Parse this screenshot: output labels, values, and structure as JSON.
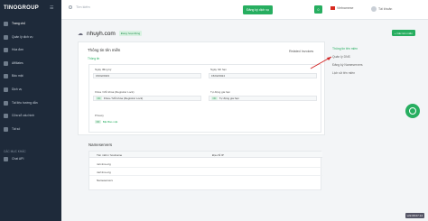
{
  "brand": {
    "logo_text": "TINOGROUP",
    "accent": "#27ae60",
    "sidebar_bg": "#1e2a3a"
  },
  "sidebar": {
    "items": [
      {
        "label": "Trang chủ",
        "active": true
      },
      {
        "label": "Quản lý dịch vụ"
      },
      {
        "label": "Hóa đơn"
      },
      {
        "label": "Affiliates"
      },
      {
        "label": "Bảo mật"
      },
      {
        "label": "Dịch vụ"
      },
      {
        "label": "Tài liệu hướng dẫn"
      },
      {
        "label": "Cửa sổ cấu hình"
      },
      {
        "label": "Tài số"
      }
    ],
    "section_label": "CÁC MỤC KHÁC",
    "extra_item": "Chat API"
  },
  "topbar": {
    "search_placeholder": "Tìm kiếm",
    "register_button": "Đăng ký dịch vụ",
    "cart_count": "0",
    "language": "Vietnamese",
    "user_name": "Tài khoản"
  },
  "domain": {
    "name": "nhuyh.com",
    "status": "Đang hoạt động",
    "add_button": "+ Các tên miền"
  },
  "details": {
    "title": "Thông tin tên miền",
    "tab_overview": "Thông tin",
    "reg_date_label": "Ngày đăng ký",
    "reg_date_value": "15/02/2023",
    "exp_date_label": "Ngày hết hạn",
    "exp_date_value": "15/02/2024",
    "lock_label": "Khóa / Mở khóa (Registrar Lock)",
    "lock_pill": "ON",
    "lock_value": "Khóa / Mở khóa (Registrar Lock)",
    "renew_label": "Tự động gia hạn",
    "renew_pill": "ON",
    "renew_value": "Tự động gia hạn",
    "privacy_label": "Privacy",
    "privacy_pill": "ON",
    "privacy_value": "Bật Bảo mật"
  },
  "related": {
    "label": "Related Invoices"
  },
  "side_links": [
    {
      "label": "Thông tin tên miền",
      "active": true
    },
    {
      "label": "Quản lý DNS"
    },
    {
      "label": "Đăng ký Nameservers"
    },
    {
      "label": "Lịch sử tên miền"
    }
  ],
  "nameservers": {
    "title": "Nameservers",
    "col_host": "Tên miền / hostname",
    "col_ip": "Địa chỉ IP",
    "rows": [
      {
        "host": "ns1.tino.org",
        "ip": ""
      },
      {
        "host": "ns2.tino.org",
        "ip": ""
      },
      {
        "host": "Nameservers",
        "ip": ""
      }
    ]
  },
  "footer": {
    "version": "v22.08.07.14"
  },
  "icons": {
    "search": "search-icon",
    "cart": "cart-icon",
    "cloud": "cloud-icon",
    "chat": "chat-icon",
    "flag": "vietnam-flag-icon",
    "menu_toggle": "menu-toggle-icon"
  }
}
